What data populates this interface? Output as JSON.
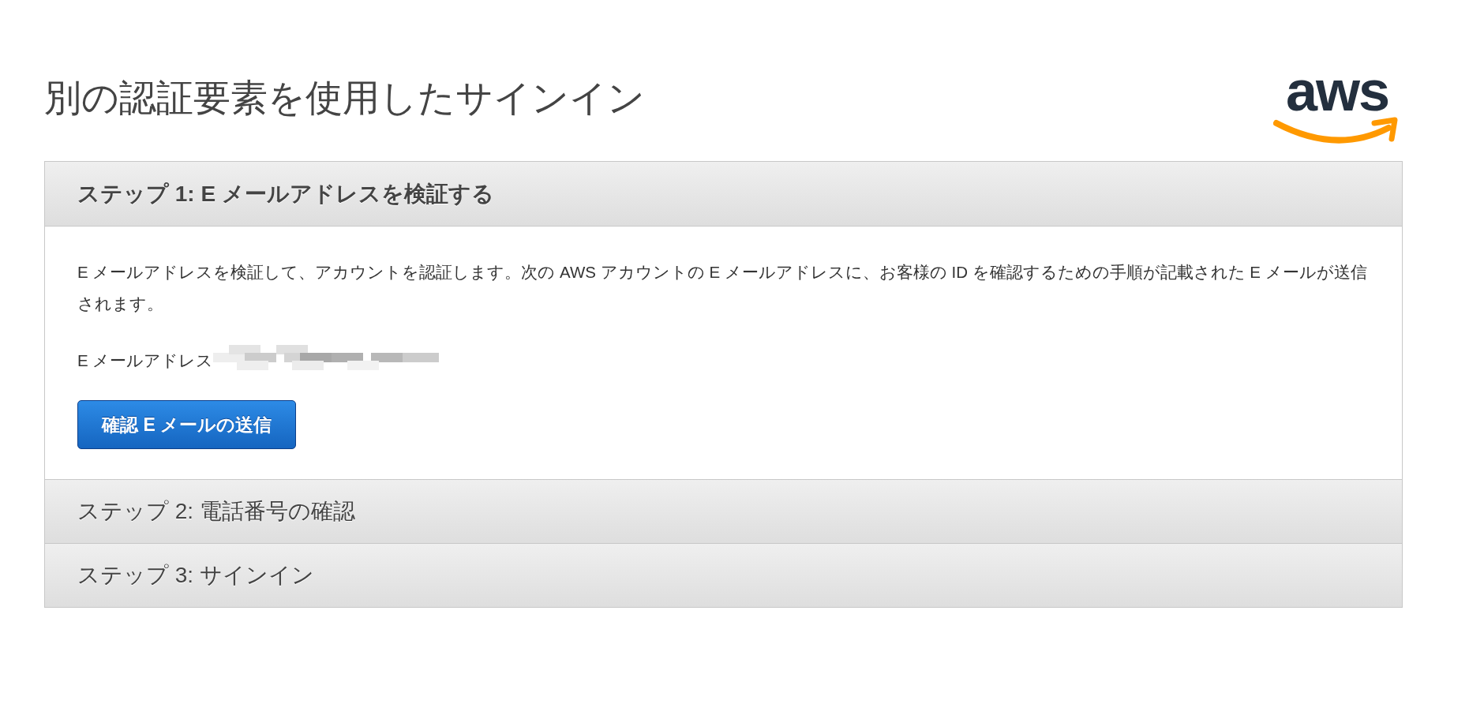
{
  "title": "別の認証要素を使用したサインイン",
  "logo": {
    "text": "aws"
  },
  "steps": [
    {
      "label": "ステップ 1: E メールアドレスを検証する",
      "expanded": true,
      "body": {
        "description": "E メールアドレスを検証して、アカウントを認証します。次の AWS アカウントの E メールアドレスに、お客様の ID を確認するための手順が記載された E メールが送信されます。",
        "email_label": "E メールアドレス",
        "button": "確認 E メールの送信"
      }
    },
    {
      "label": "ステップ 2: 電話番号の確認",
      "expanded": false
    },
    {
      "label": "ステップ 3: サインイン",
      "expanded": false
    }
  ]
}
